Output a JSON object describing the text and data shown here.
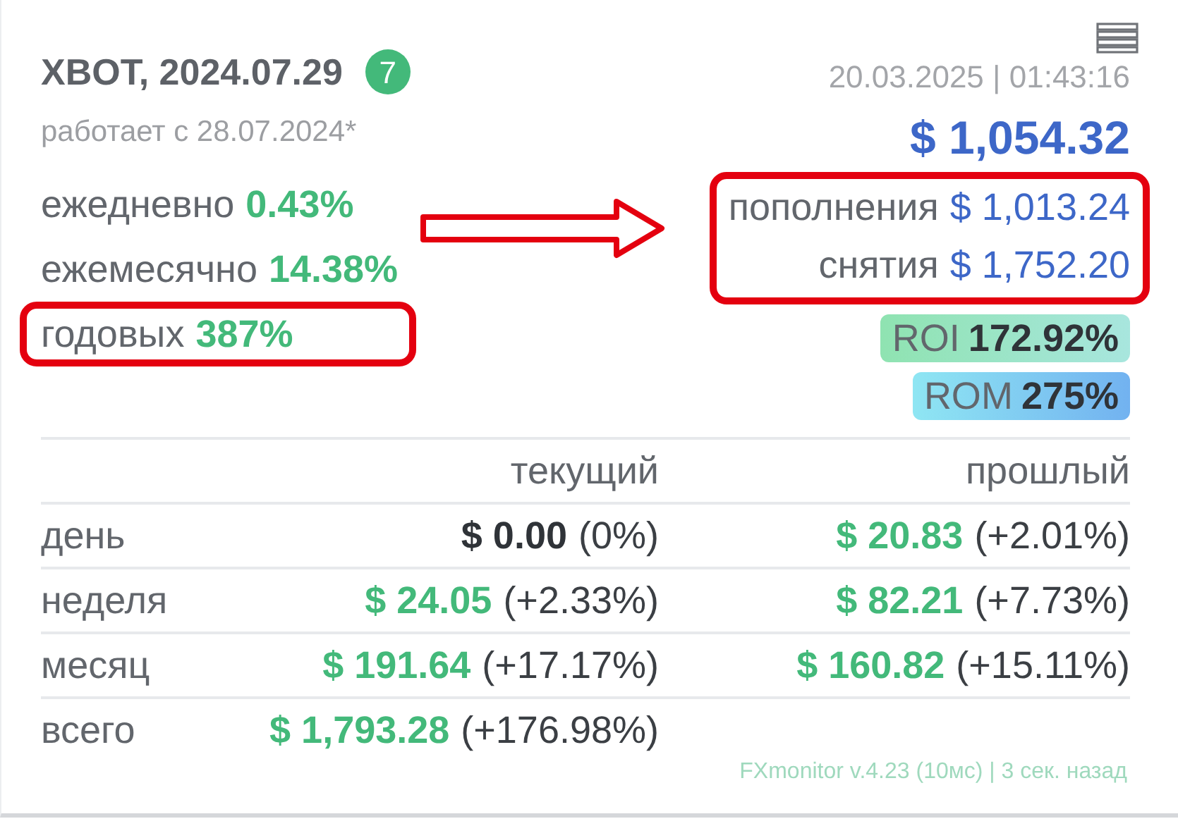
{
  "header": {
    "title": "XBOT, 2024.07.29",
    "badge": "7",
    "datetime": "20.03.2025 | 01:43:16",
    "subtitle": "работает с 28.07.2024*",
    "balance": "$ 1,054.32"
  },
  "rates": [
    {
      "label": "ежедневно",
      "value": "0.43%",
      "highlighted": false
    },
    {
      "label": "ежемесячно",
      "value": "14.38%",
      "highlighted": false
    },
    {
      "label": "годовых",
      "value": "387%",
      "highlighted": true
    }
  ],
  "flows": {
    "highlighted": true,
    "items": [
      {
        "label": "пополнения",
        "value": "$ 1,013.24"
      },
      {
        "label": "снятия",
        "value": "$ 1,752.20"
      }
    ]
  },
  "ratios": [
    {
      "kind": "roi",
      "label": "ROI",
      "value": "172.92%"
    },
    {
      "kind": "rom",
      "label": "ROM",
      "value": "275%"
    }
  ],
  "table": {
    "columns": [
      "текущий",
      "прошлый"
    ],
    "rows": [
      {
        "label": "день",
        "cells": [
          {
            "amount": "$ 0.00",
            "percent": "(0%)",
            "color": "#2f3338"
          },
          {
            "amount": "$ 20.83",
            "percent": "(+2.01%)",
            "color": "#43b97a"
          }
        ]
      },
      {
        "label": "неделя",
        "cells": [
          {
            "amount": "$ 24.05",
            "percent": "(+2.33%)",
            "color": "#43b97a"
          },
          {
            "amount": "$ 82.21",
            "percent": "(+7.73%)",
            "color": "#43b97a"
          }
        ]
      },
      {
        "label": "месяц",
        "cells": [
          {
            "amount": "$ 191.64",
            "percent": "(+17.17%)",
            "color": "#43b97a"
          },
          {
            "amount": "$ 160.82",
            "percent": "(+15.11%)",
            "color": "#43b97a"
          }
        ]
      },
      {
        "label": "всего",
        "cells": [
          {
            "amount": "$ 1,793.28",
            "percent": "(+176.98%)",
            "color": "#43b97a"
          }
        ]
      }
    ]
  },
  "footer": "FXmonitor v.4.23 (10мс) | 3 сек. назад"
}
